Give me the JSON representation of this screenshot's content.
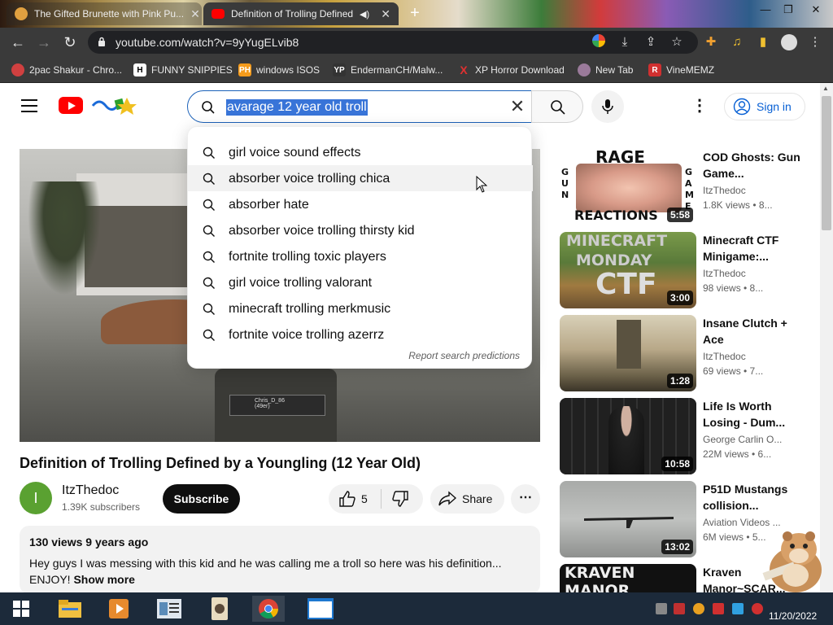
{
  "browser": {
    "tabs": [
      {
        "title": "The Gifted Brunette with Pink Pu..."
      },
      {
        "title": "Definition of Trolling Defined"
      }
    ],
    "url": "youtube.com/watch?v=9yYugELvib8",
    "bookmarks": [
      {
        "label": "2pac Shakur - Chro..."
      },
      {
        "label": "FUNNY SNIPPIES"
      },
      {
        "label": "windows ISOS"
      },
      {
        "label": "EndermanCH/Malw..."
      },
      {
        "label": "XP Horror Download"
      },
      {
        "label": "New Tab"
      },
      {
        "label": "VineMEMZ"
      }
    ]
  },
  "header": {
    "search_query": "avarage 12 year old troll",
    "signin_label": "Sign in"
  },
  "suggestions": [
    "girl voice sound effects",
    "absorber voice trolling chica",
    "absorber hate",
    "absorber voice trolling thirsty kid",
    "fortnite trolling toxic players",
    "girl voice trolling valorant",
    "minecraft trolling merkmusic",
    "fortnite voice trolling azerrz"
  ],
  "report_label": "Report search predictions",
  "video": {
    "title": "Definition of Trolling Defined by a Youngling (12 Year Old)",
    "overlay_tag_line1": "Chris_D_86",
    "overlay_tag_line2": "(49er)",
    "channel": "ItzThedoc",
    "avatar_letter": "I",
    "subscribers": "1.39K subscribers",
    "subscribe_label": "Subscribe",
    "likes": "5",
    "share_label": "Share",
    "views_date": "130 views  9 years ago",
    "description": "Hey guys I was messing with this kid and he was calling me a troll so here was his definition... ENJOY!",
    "show_more": "Show more"
  },
  "sidebar": [
    {
      "title": "COD Ghosts: Gun Game...",
      "channel": "ItzThedoc",
      "views": "1.8K views • 8...",
      "duration": "5:58",
      "thumb_text": "RAGE",
      "thumb_sub": "REACTIONS",
      "thumb_left": "GUN",
      "thumb_right": "GAME"
    },
    {
      "title": "Minecraft CTF Minigame:...",
      "channel": "ItzThedoc",
      "views": "98 views • 8...",
      "duration": "3:00",
      "thumb_text": "MINECRAFT",
      "thumb_sub": "MONDAY",
      "thumb_big": "CTF"
    },
    {
      "title": "Insane Clutch + Ace",
      "channel": "ItzThedoc",
      "views": "69 views • 7...",
      "duration": "1:28"
    },
    {
      "title": "Life Is Worth Losing - Dum...",
      "channel": "George Carlin O...",
      "views": "22M views • 6...",
      "duration": "10:58"
    },
    {
      "title": "P51D Mustangs collision...",
      "channel": "Aviation Videos ...",
      "views": "6M views • 5...",
      "duration": "13:02"
    },
    {
      "title": "Kraven Manor~SCAR...",
      "thumb_text": "KRAVEN MANOR"
    }
  ],
  "taskbar": {
    "date": "11/20/2022"
  },
  "colors": {
    "yt_red": "#ff0000",
    "link_blue": "#065fd4",
    "selection_blue": "#3874d8"
  }
}
